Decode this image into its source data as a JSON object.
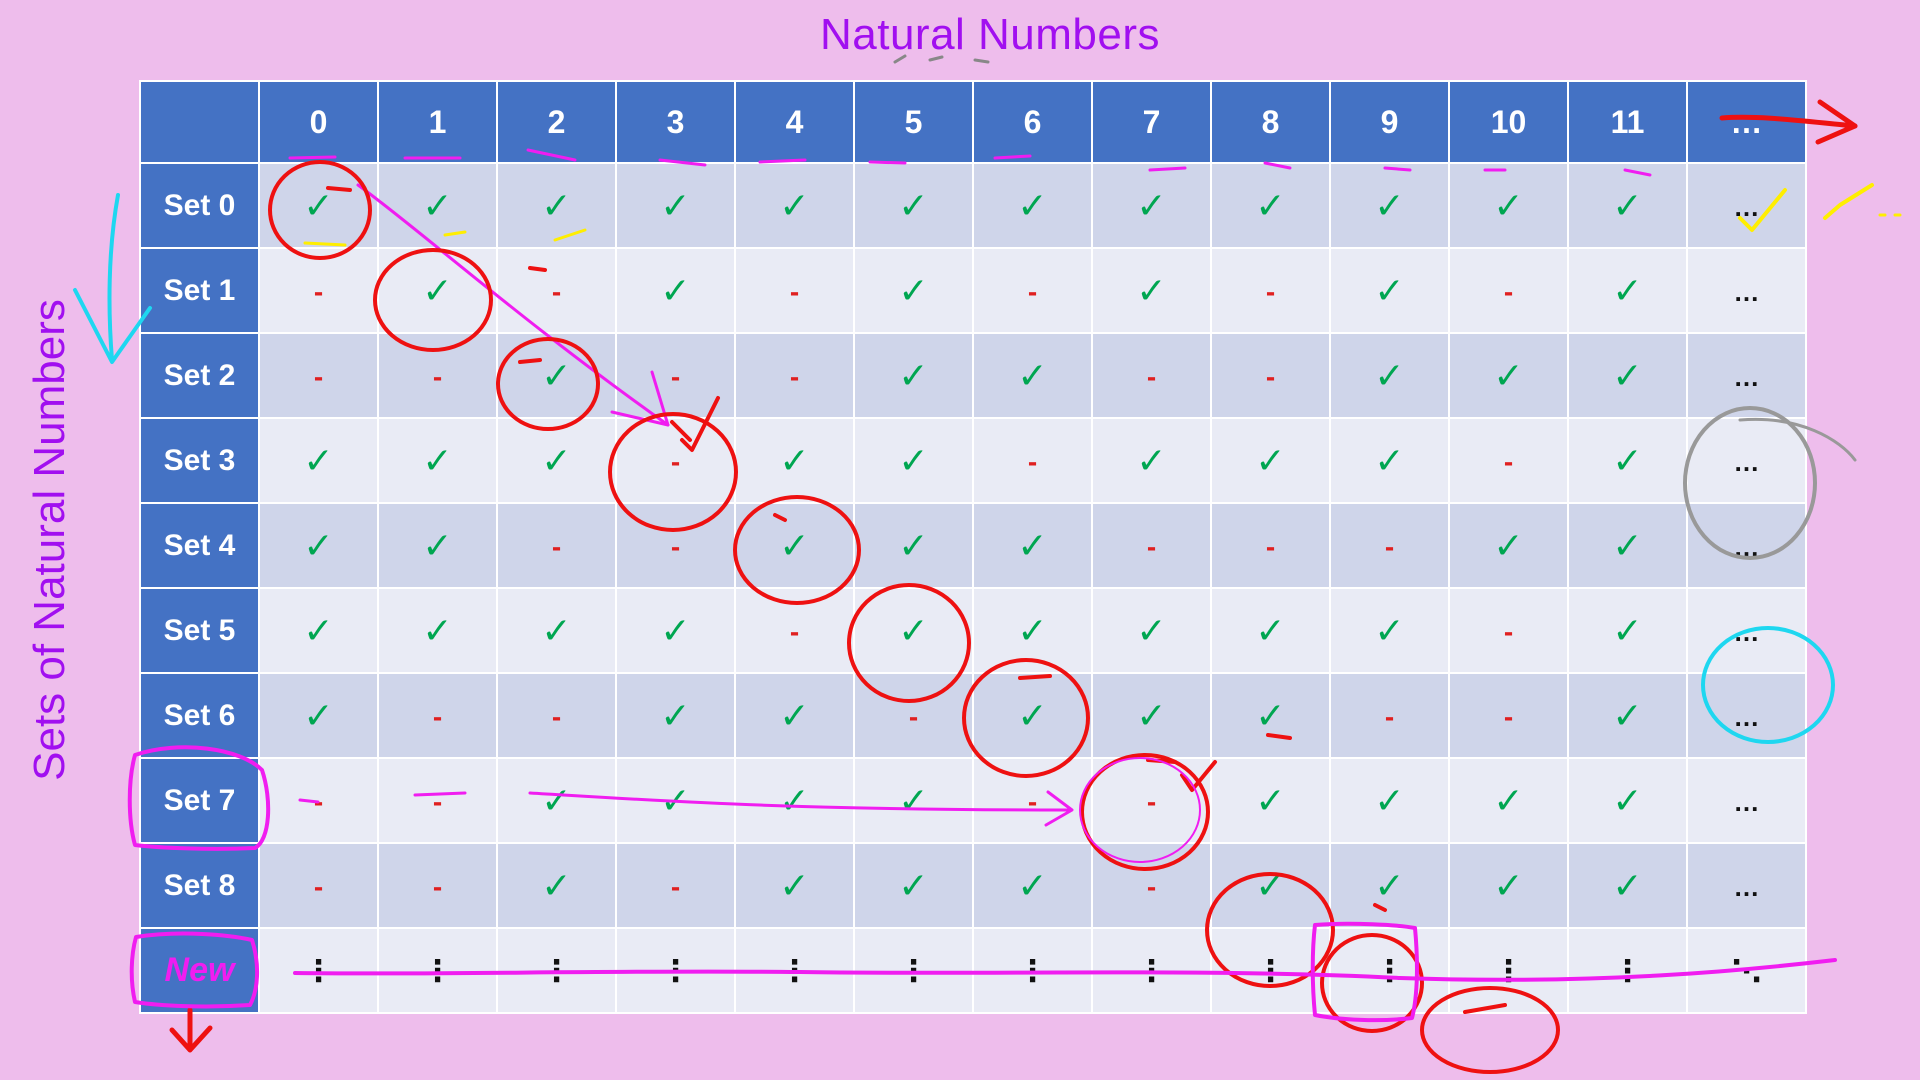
{
  "title": "Natural Numbers",
  "side_title": "Sets of Natural Numbers",
  "columns": [
    "0",
    "1",
    "2",
    "3",
    "4",
    "5",
    "6",
    "7",
    "8",
    "9",
    "10",
    "11",
    "…"
  ],
  "rows": [
    {
      "label": "Set 0",
      "cells": [
        "c",
        "c",
        "c",
        "c",
        "c",
        "c",
        "c",
        "c",
        "c",
        "c",
        "c",
        "c",
        "y"
      ]
    },
    {
      "label": "Set 1",
      "cells": [
        "d",
        "c",
        "d",
        "c",
        "d",
        "c",
        "d",
        "c",
        "d",
        "c",
        "d",
        "c",
        "e"
      ]
    },
    {
      "label": "Set 2",
      "cells": [
        "d",
        "d",
        "c",
        "d",
        "d",
        "c",
        "c",
        "d",
        "d",
        "c",
        "c",
        "c",
        "e"
      ]
    },
    {
      "label": "Set 3",
      "cells": [
        "c",
        "c",
        "c",
        "d",
        "c",
        "c",
        "d",
        "c",
        "c",
        "c",
        "d",
        "c",
        "e"
      ]
    },
    {
      "label": "Set 4",
      "cells": [
        "c",
        "c",
        "d",
        "d",
        "c",
        "c",
        "c",
        "d",
        "d",
        "d",
        "c",
        "c",
        "e"
      ]
    },
    {
      "label": "Set 5",
      "cells": [
        "c",
        "c",
        "c",
        "c",
        "d",
        "c",
        "c",
        "c",
        "c",
        "c",
        "d",
        "c",
        "e"
      ]
    },
    {
      "label": "Set 6",
      "cells": [
        "c",
        "d",
        "d",
        "c",
        "c",
        "d",
        "c",
        "c",
        "c",
        "d",
        "d",
        "c",
        "e"
      ]
    },
    {
      "label": "Set 7",
      "cells": [
        "d",
        "d",
        "c",
        "c",
        "c",
        "c",
        "d",
        "d",
        "c",
        "c",
        "c",
        "c",
        "e"
      ]
    },
    {
      "label": "Set 8",
      "cells": [
        "d",
        "d",
        "c",
        "d",
        "c",
        "c",
        "c",
        "d",
        "c",
        "c",
        "c",
        "c",
        "e"
      ]
    },
    {
      "label": "New",
      "cells": [
        "v",
        "v",
        "v",
        "v",
        "v",
        "v",
        "v",
        "v",
        "v",
        "v",
        "v",
        "v",
        "x"
      ]
    }
  ],
  "symbols": {
    "check": "✓",
    "dash": "-",
    "ellipsis": "…",
    "vdots": "⋮",
    "ddots": "⋱"
  },
  "colors": {
    "background": "#eebdec",
    "header": "#4472c4",
    "row_dark": "#cfd5ea",
    "row_light": "#e9ebf5",
    "check": "#00a651",
    "dash": "#e02020",
    "title": "#a10ff0",
    "ink_red": "#ee1111",
    "ink_magenta": "#f01df0",
    "ink_cyan": "#1ed7f0",
    "ink_yellow": "#ffee00",
    "ink_gray": "#999999"
  }
}
